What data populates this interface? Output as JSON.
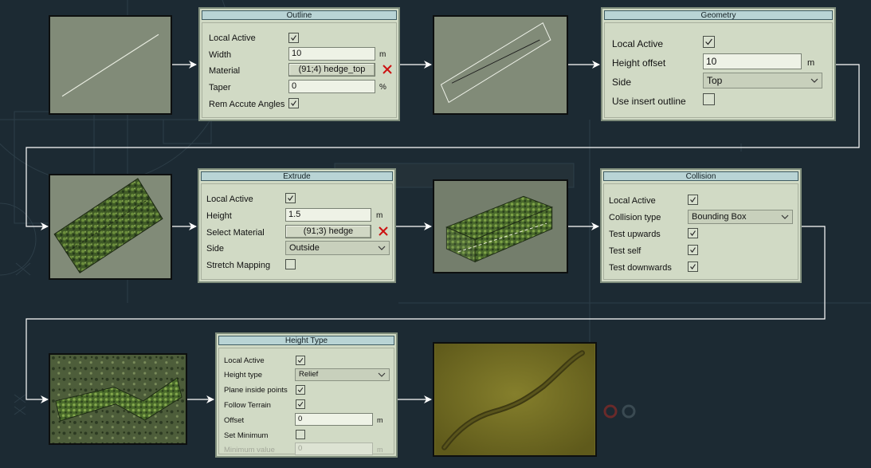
{
  "outline": {
    "title": "Outline",
    "local_active_label": "Local Active",
    "width_label": "Width",
    "width_value": "10",
    "width_unit": "m",
    "material_label": "Material",
    "material_value": "(91;4) hedge_top",
    "taper_label": "Taper",
    "taper_value": "0",
    "taper_unit": "%",
    "rem_accute_label": "Rem Accute Angles"
  },
  "geometry": {
    "title": "Geometry",
    "local_active_label": "Local Active",
    "height_offset_label": "Height offset",
    "height_offset_value": "10",
    "height_offset_unit": "m",
    "side_label": "Side",
    "side_value": "Top",
    "use_insert_label": "Use insert outline"
  },
  "extrude": {
    "title": "Extrude",
    "local_active_label": "Local Active",
    "height_label": "Height",
    "height_value": "1.5",
    "height_unit": "m",
    "select_material_label": "Select Material",
    "select_material_value": "(91;3) hedge",
    "side_label": "Side",
    "side_value": "Outside",
    "stretch_label": "Stretch Mapping"
  },
  "collision": {
    "title": "Collision",
    "local_active_label": "Local Active",
    "type_label": "Collision type",
    "type_value": "Bounding Box",
    "up_label": "Test upwards",
    "self_label": "Test self",
    "down_label": "Test downwards"
  },
  "height_type": {
    "title": "Height Type",
    "local_active_label": "Local Active",
    "type_label": "Height type",
    "type_value": "Relief",
    "plane_label": "Plane inside points",
    "follow_label": "Follow Terrain",
    "offset_label": "Offset",
    "offset_value": "0",
    "offset_unit": "m",
    "set_min_label": "Set Minimum",
    "min_value_label": "Minimum value",
    "min_value_value": "0",
    "min_value_unit": "m"
  },
  "colors": {
    "panel": "#d1dac5",
    "title_bar": "#b9d4d5",
    "arrow": "#ffffff",
    "remove_x": "#cc1111"
  }
}
